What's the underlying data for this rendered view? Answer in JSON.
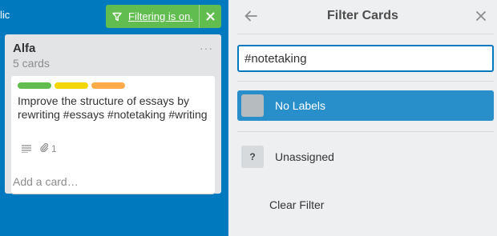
{
  "board": {
    "header_fragment": "lic",
    "filter_banner": {
      "text": "Filtering is on."
    },
    "list": {
      "title": "Alfa",
      "count": "5 cards",
      "menu": "···",
      "add_card": "Add a card…",
      "cards": [
        {
          "labels": [
            {
              "color": "#61bd4f"
            },
            {
              "color": "#f2d600"
            },
            {
              "color": "#ffab4a"
            }
          ],
          "title": "Improve the structure of essays by rewriting #essays #notetaking #writing",
          "attachments": "1"
        }
      ]
    }
  },
  "panel": {
    "title": "Filter Cards",
    "search_value": "#notetaking",
    "items": [
      {
        "label": "No Labels",
        "selected": true
      },
      {
        "label": "Unassigned",
        "icon_text": "?",
        "selected": false
      }
    ],
    "clear_filter": "Clear Filter"
  },
  "colors": {
    "board_bg": "#0079bf",
    "banner_green": "#61bd4f",
    "selected_blue": "#298fca",
    "panel_bg": "#edeff0"
  }
}
